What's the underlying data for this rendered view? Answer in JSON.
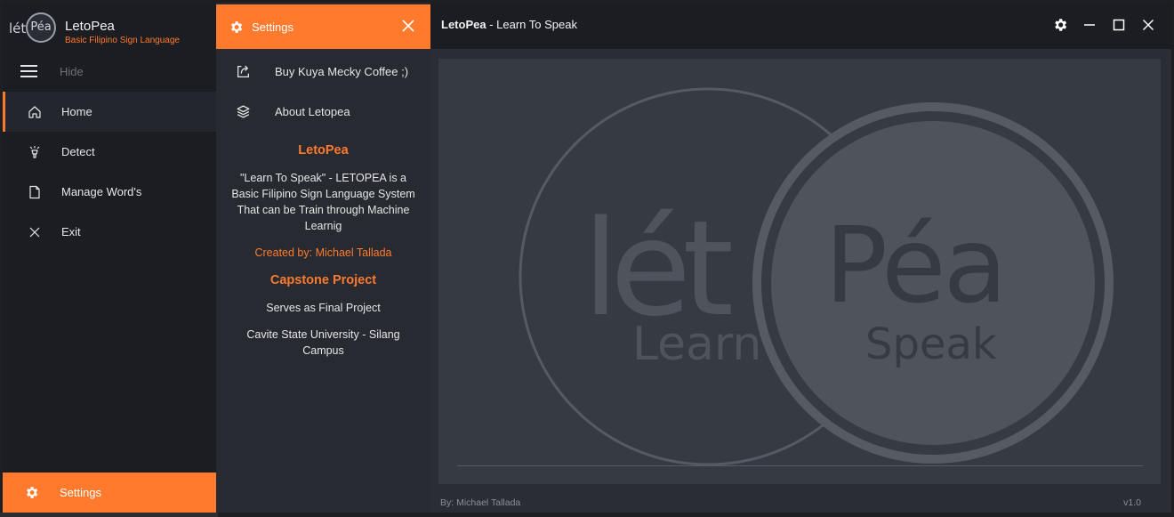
{
  "brand": {
    "logo_left": "lét",
    "logo_right": "Péa",
    "name": "LetoPea",
    "subtitle": "Basic Filipino Sign Language"
  },
  "sidebar": {
    "toggle_label": "Hide",
    "items": [
      {
        "label": "Home",
        "icon": "home-icon"
      },
      {
        "label": "Detect",
        "icon": "lamp-icon"
      },
      {
        "label": "Manage Word's",
        "icon": "document-icon"
      },
      {
        "label": "Exit",
        "icon": "close-icon"
      }
    ],
    "settings_label": "Settings"
  },
  "settings_panel": {
    "title": "Settings",
    "items": [
      {
        "label": "Buy Kuya Mecky Coffee ;)",
        "icon": "share-icon"
      },
      {
        "label": "About Letopea",
        "icon": "layers-icon"
      }
    ],
    "about": {
      "app_name": "LetoPea",
      "description": "\"Learn To Speak\" - LETOPEA is a Basic Filipino Sign Language System That can be Train through Machine Learnig",
      "created_by": "Created by: Michael Tallada",
      "project_heading": "Capstone Project",
      "project_purpose": "Serves as Final Project",
      "school": "Cavite State University - Silang Campus"
    }
  },
  "main": {
    "title_bold": "LetoPea",
    "title_rest": " - Learn To Speak",
    "splash": {
      "word_left": "lét",
      "word_right": "Péa",
      "sub_left": "Learn",
      "sub_right": "Speak"
    },
    "footer_left": "By: Michael  Tallada",
    "footer_right": "v1.0"
  },
  "colors": {
    "accent": "#ff7a2d",
    "sidebar_bg": "#1b1d23",
    "panel_bg": "#272a31",
    "splash_bg": "#363a43"
  }
}
